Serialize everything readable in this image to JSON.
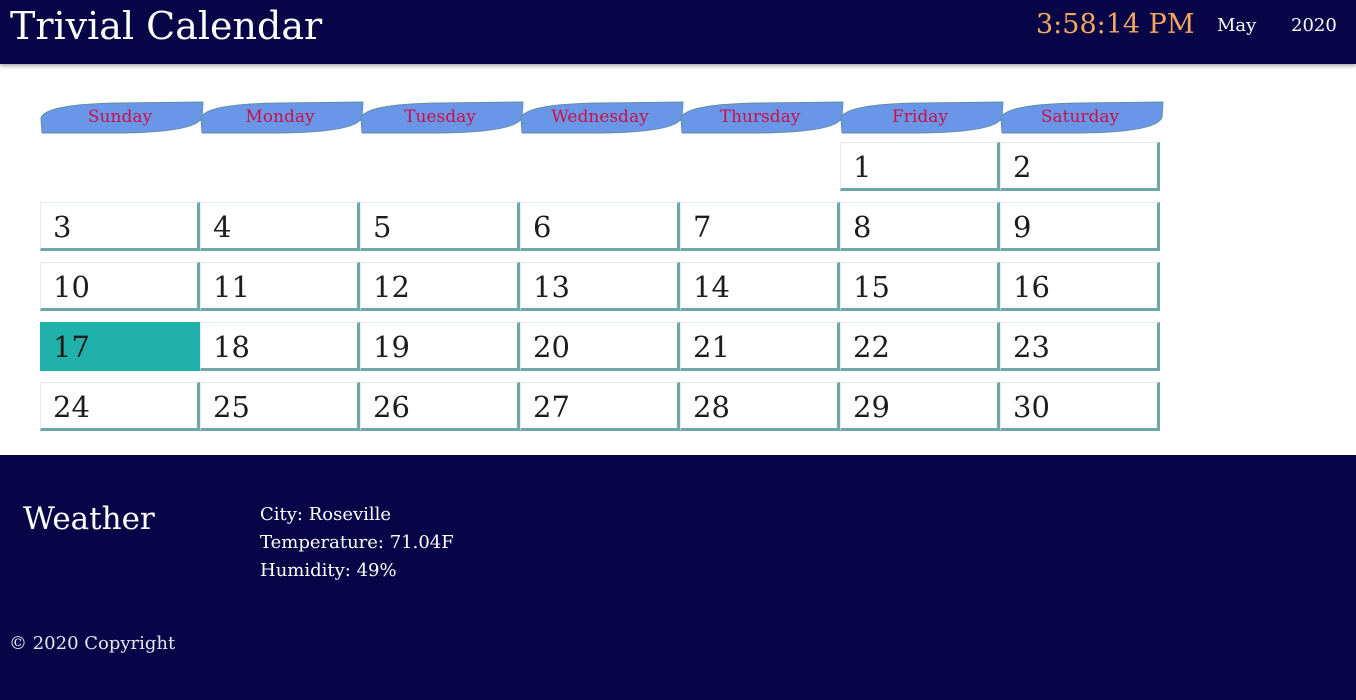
{
  "header": {
    "title": "Trivial Calendar",
    "clock": "3:58:14 PM",
    "month": "May",
    "year": "2020",
    "colors": {
      "background": "#070447",
      "clock": "#f5a75c"
    }
  },
  "calendar": {
    "weekdays": [
      "Sunday",
      "Monday",
      "Tuesday",
      "Wednesday",
      "Thursday",
      "Friday",
      "Saturday"
    ],
    "first_weekday_index": 5,
    "days": [
      "1",
      "2",
      "3",
      "4",
      "5",
      "6",
      "7",
      "8",
      "9",
      "10",
      "11",
      "12",
      "13",
      "14",
      "15",
      "16",
      "17",
      "18",
      "19",
      "20",
      "21",
      "22",
      "23",
      "24",
      "25",
      "26",
      "27",
      "28",
      "29",
      "30"
    ],
    "today": "17",
    "colors": {
      "weekday_tab": "#6a96e8",
      "weekday_text": "#c8104a",
      "today": "#20b2aa",
      "cell_border": "#6ea6aa"
    }
  },
  "footer": {
    "weather_heading": "Weather",
    "city": "City: Roseville",
    "temperature": "Temperature: 71.04F",
    "humidity": "Humidity: 49%",
    "copyright": "© 2020 Copyright"
  }
}
